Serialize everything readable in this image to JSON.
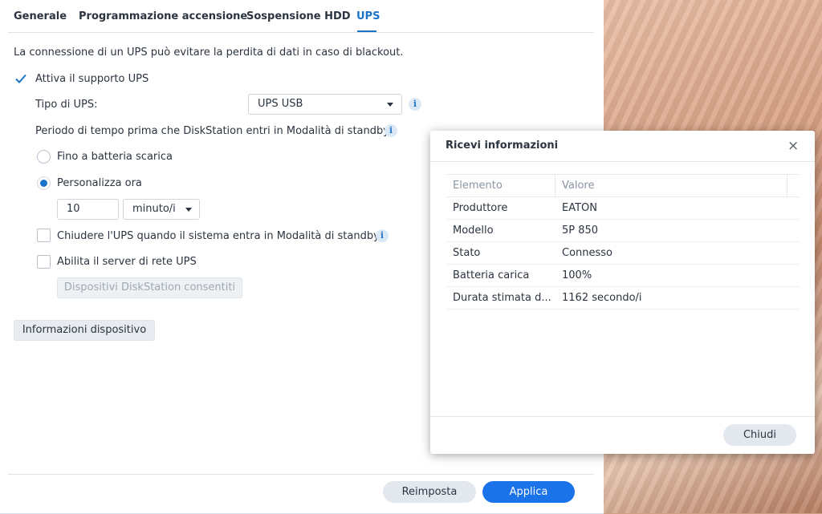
{
  "tabs": [
    {
      "label": "Generale"
    },
    {
      "label": "Programmazione accensione"
    },
    {
      "label": "Sospensione HDD"
    },
    {
      "label": "UPS"
    }
  ],
  "active_tab": "UPS",
  "intro_text": "La connessione di un UPS può evitare la perdita di dati in caso di blackout.",
  "enable_ups": {
    "label": "Attiva il supporto UPS",
    "checked": true
  },
  "ups_type": {
    "label": "Tipo di UPS:",
    "value": "UPS USB"
  },
  "standby_period_label": "Periodo di tempo prima che DiskStation entri in Modalità di standby.",
  "radio_until_low_battery": {
    "label": "Fino a batteria scarica",
    "checked": false
  },
  "radio_custom_time": {
    "label": "Personalizza ora",
    "checked": true
  },
  "time_value": "10",
  "time_unit": "minuto/i",
  "shutdown_ups": {
    "label": "Chiudere l'UPS quando il sistema entra in Modalità di standby.",
    "checked": false
  },
  "network_server": {
    "label": "Abilita il server di rete UPS",
    "checked": false
  },
  "allowed_devices_button": "Dispositivi DiskStation consentiti",
  "device_info_button": "Informazioni dispositivo",
  "footer": {
    "reset": "Reimposta",
    "apply": "Applica"
  },
  "dialog": {
    "title": "Ricevi informazioni",
    "close_symbol": "×",
    "columns": [
      "Elemento",
      "Valore"
    ],
    "rows": [
      [
        "Produttore",
        "EATON"
      ],
      [
        "Modello",
        "5P 850"
      ],
      [
        "Stato",
        "Connesso"
      ],
      [
        "Batteria carica",
        "100%"
      ],
      [
        "Durata stimata d...",
        "1162 secondo/i"
      ]
    ],
    "close_button": "Chiudi"
  },
  "colors": {
    "accent": "#1a73c8",
    "primary_button": "#1a73e8"
  }
}
